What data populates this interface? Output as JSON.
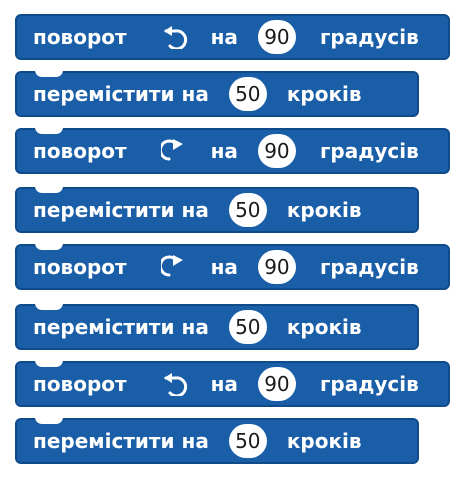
{
  "blocks": [
    {
      "verb": "поворот",
      "direction_icon": "rotate-left-icon",
      "prep": "на",
      "value": "90",
      "unit": "градусів"
    },
    {
      "verb": "перемістити на",
      "value": "50",
      "unit": "кроків"
    },
    {
      "verb": "поворот",
      "direction_icon": "rotate-right-icon",
      "prep": "на",
      "value": "90",
      "unit": "градусів"
    },
    {
      "verb": "перемістити на",
      "value": "50",
      "unit": "кроків"
    },
    {
      "verb": "поворот",
      "direction_icon": "rotate-right-icon",
      "prep": "на",
      "value": "90",
      "unit": "градусів"
    },
    {
      "verb": "перемістити на",
      "value": "50",
      "unit": "кроків"
    },
    {
      "verb": "поворот",
      "direction_icon": "rotate-left-icon",
      "prep": "на",
      "value": "90",
      "unit": "градусів"
    },
    {
      "verb": "перемістити на",
      "value": "50",
      "unit": "кроків"
    }
  ],
  "colors": {
    "block": "#1a5ea8",
    "block_border": "#0f4a8a",
    "input_bg": "#ffffff",
    "text": "#ffffff"
  }
}
